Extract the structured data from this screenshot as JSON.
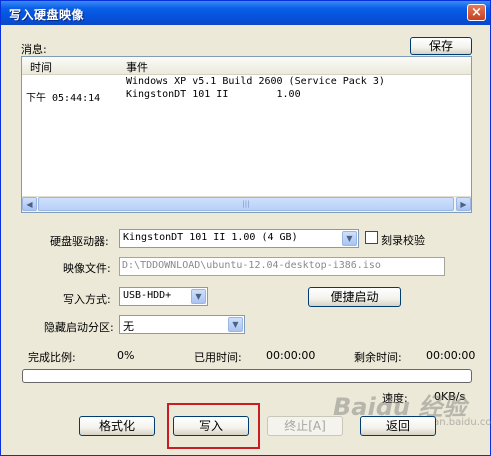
{
  "window": {
    "title": "写入硬盘映像",
    "close_glyph": "×"
  },
  "messages": {
    "label": "消息:",
    "save_button": "保存",
    "columns": [
      "时间",
      "事件"
    ],
    "rows": [
      {
        "time": "",
        "event": "Windows XP v5.1 Build 2600 (Service Pack 3)"
      },
      {
        "time": "下午 05:44:14",
        "event": "KingstonDT 101 II        1.00"
      }
    ],
    "scroll_left": "◀",
    "scroll_right": "▶",
    "scroll_grip": "|||"
  },
  "form": {
    "drive_label": "硬盘驱动器:",
    "drive_value": "KingstonDT 101 II        1.00 (4 GB)",
    "burn_verify_label": "刻录校验",
    "image_label": "映像文件:",
    "image_value": "D:\\TDDOWNLOAD\\ubuntu-12.04-desktop-i386.iso",
    "write_mode_label": "写入方式:",
    "write_mode_value": "USB-HDD+",
    "quick_boot_button": "便捷启动",
    "hidden_partition_label": "隐藏启动分区:",
    "hidden_partition_value": "无",
    "dropdown_glyph": "▼"
  },
  "status": {
    "completion_label": "完成比例:",
    "completion_value": "0%",
    "elapsed_label": "已用时间:",
    "elapsed_value": "00:00:00",
    "remaining_label": "剩余时间:",
    "remaining_value": "00:00:00",
    "progress": 0,
    "speed_label": "速度:",
    "speed_value": "0KB/s"
  },
  "buttons": {
    "format": "格式化",
    "write": "写入",
    "stop": "终止[A]",
    "back": "返回"
  },
  "watermark": {
    "text": "Baidu 经验",
    "sub": "jingyan.baidu.com"
  }
}
